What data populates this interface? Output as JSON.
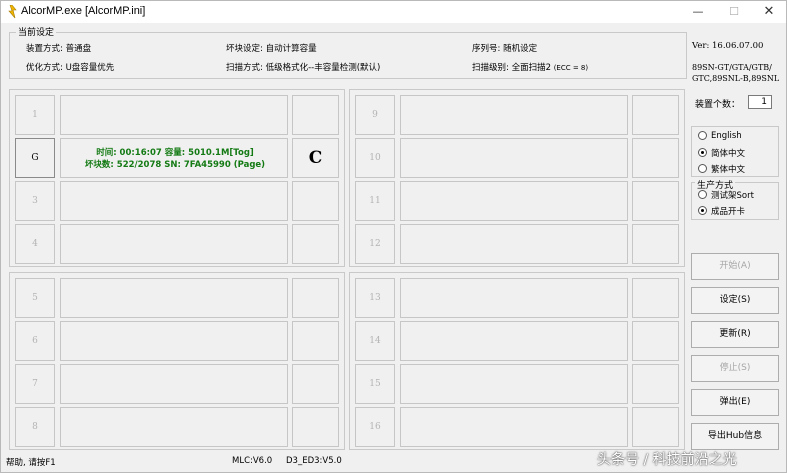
{
  "window": {
    "title": "AlcorMP.exe [AlcorMP.ini]",
    "min_glyph": "—",
    "max_glyph": "☐",
    "close_glyph": "✕"
  },
  "settings": {
    "legend": "当前设定",
    "device_mode": "装置方式: 普通盘",
    "optimize_mode": "优化方式: U盘容量优先",
    "badblock_setting": "坏块设定: 自动计算容量",
    "scan_mode": "扫描方式: 低级格式化--丰容量检测(默认)",
    "serial": "序列号: 随机设定",
    "scan_level": "扫描级别: 全面扫描2",
    "scan_level_ecc": "(ECC = 8)"
  },
  "side": {
    "version": "Ver: 16.06.07.00",
    "models": [
      "89SN-GT/GTA/GTB/",
      "GTC,89SNL-B,89SNL"
    ],
    "device_count_label": "装置个数：",
    "device_count": "1",
    "languages": [
      {
        "label": "English",
        "selected": false
      },
      {
        "label": "简体中文",
        "selected": true
      },
      {
        "label": "繁体中文",
        "selected": false
      }
    ],
    "production_legend": "生产方式",
    "production": [
      {
        "label": "测试架Sort",
        "selected": false
      },
      {
        "label": "成品开卡",
        "selected": true
      }
    ],
    "buttons": [
      {
        "label": "开始(A)",
        "enabled": false
      },
      {
        "label": "设定(S)",
        "enabled": true
      },
      {
        "label": "更新(R)",
        "enabled": true
      },
      {
        "label": "停止(S)",
        "enabled": false
      },
      {
        "label": "弹出(E)",
        "enabled": true
      },
      {
        "label": "导出Hub信息",
        "enabled": true
      }
    ]
  },
  "ports": {
    "p1": {
      "label": "1"
    },
    "p2": {
      "label": "G",
      "line1": "时间: 00:16:07 容量: 5010.1M[Tog]",
      "line2": "坏块数: 522/2078 SN: 7FA45990 (Page)",
      "status": "C"
    },
    "p3": {
      "label": "3"
    },
    "p4": {
      "label": "4"
    },
    "p5": {
      "label": "5"
    },
    "p6": {
      "label": "6"
    },
    "p7": {
      "label": "7"
    },
    "p8": {
      "label": "8"
    },
    "p9": {
      "label": "9"
    },
    "p10": {
      "label": "10"
    },
    "p11": {
      "label": "11"
    },
    "p12": {
      "label": "12"
    },
    "p13": {
      "label": "13"
    },
    "p14": {
      "label": "14"
    },
    "p15": {
      "label": "15"
    },
    "p16": {
      "label": "16"
    }
  },
  "statusbar": {
    "help": "帮助, 请按F1",
    "mlc": "MLC:V6.0",
    "ed3": "D3_ED3:V5.0"
  },
  "watermark": "头条号 / 科技前沿之光"
}
